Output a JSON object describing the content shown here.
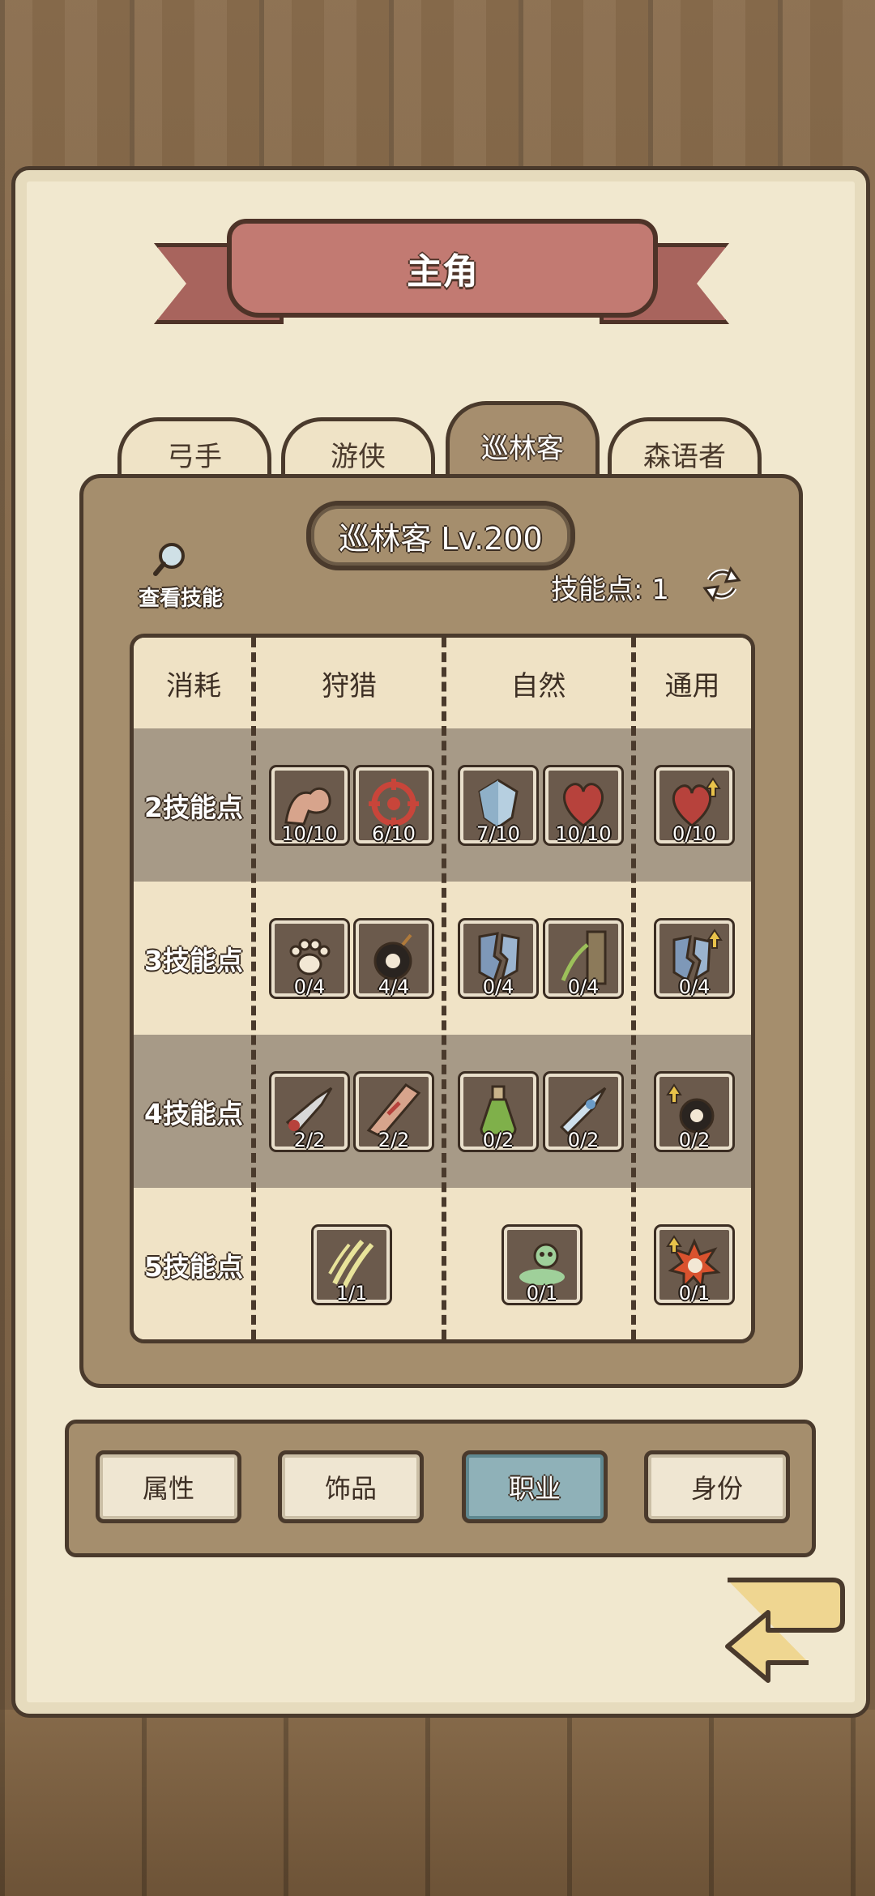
{
  "title": "主角",
  "tabs": [
    {
      "label": "弓手",
      "active": false
    },
    {
      "label": "游侠",
      "active": false
    },
    {
      "label": "巡林客",
      "active": true
    },
    {
      "label": "森语者",
      "active": false
    }
  ],
  "class_badge": "巡林客 Lv.200",
  "view_skill_label": "查看技能",
  "skill_points_label": "技能点: 1",
  "headers": {
    "cost": "消耗",
    "hunting": "狩猎",
    "nature": "自然",
    "general": "通用"
  },
  "rows": [
    {
      "cost": "2技能点",
      "hunting": [
        {
          "icon": "arm-icon",
          "count": "10/10"
        },
        {
          "icon": "target-icon",
          "count": "6/10"
        }
      ],
      "nature": [
        {
          "icon": "crystal-shield-icon",
          "count": "7/10"
        },
        {
          "icon": "heart-icon",
          "count": "10/10"
        }
      ],
      "general": [
        {
          "icon": "heart-up-icon",
          "count": "0/10"
        }
      ]
    },
    {
      "cost": "3技能点",
      "hunting": [
        {
          "icon": "paw-icon",
          "count": "0/4"
        },
        {
          "icon": "skull-bomb-icon",
          "count": "4/4"
        }
      ],
      "nature": [
        {
          "icon": "broken-shield-icon",
          "count": "0/4"
        },
        {
          "icon": "vine-tree-icon",
          "count": "0/4"
        }
      ],
      "general": [
        {
          "icon": "broken-shield-up-icon",
          "count": "0/4"
        }
      ]
    },
    {
      "cost": "4技能点",
      "hunting": [
        {
          "icon": "bloody-arrowhead-icon",
          "count": "2/2"
        },
        {
          "icon": "wound-icon",
          "count": "2/2"
        }
      ],
      "nature": [
        {
          "icon": "potion-icon",
          "count": "0/2"
        },
        {
          "icon": "ice-arrowhead-icon",
          "count": "0/2"
        }
      ],
      "general": [
        {
          "icon": "skull-bomb-up-icon",
          "count": "0/2"
        }
      ]
    },
    {
      "cost": "5技能点",
      "hunting": [
        {
          "icon": "claw-slash-icon",
          "count": "1/1"
        }
      ],
      "nature": [
        {
          "icon": "poison-skull-icon",
          "count": "0/1"
        }
      ],
      "general": [
        {
          "icon": "explosion-skull-icon",
          "count": "0/1"
        }
      ]
    }
  ],
  "nav": [
    {
      "label": "属性",
      "active": false
    },
    {
      "label": "饰品",
      "active": false
    },
    {
      "label": "职业",
      "active": true
    },
    {
      "label": "身份",
      "active": false
    }
  ]
}
